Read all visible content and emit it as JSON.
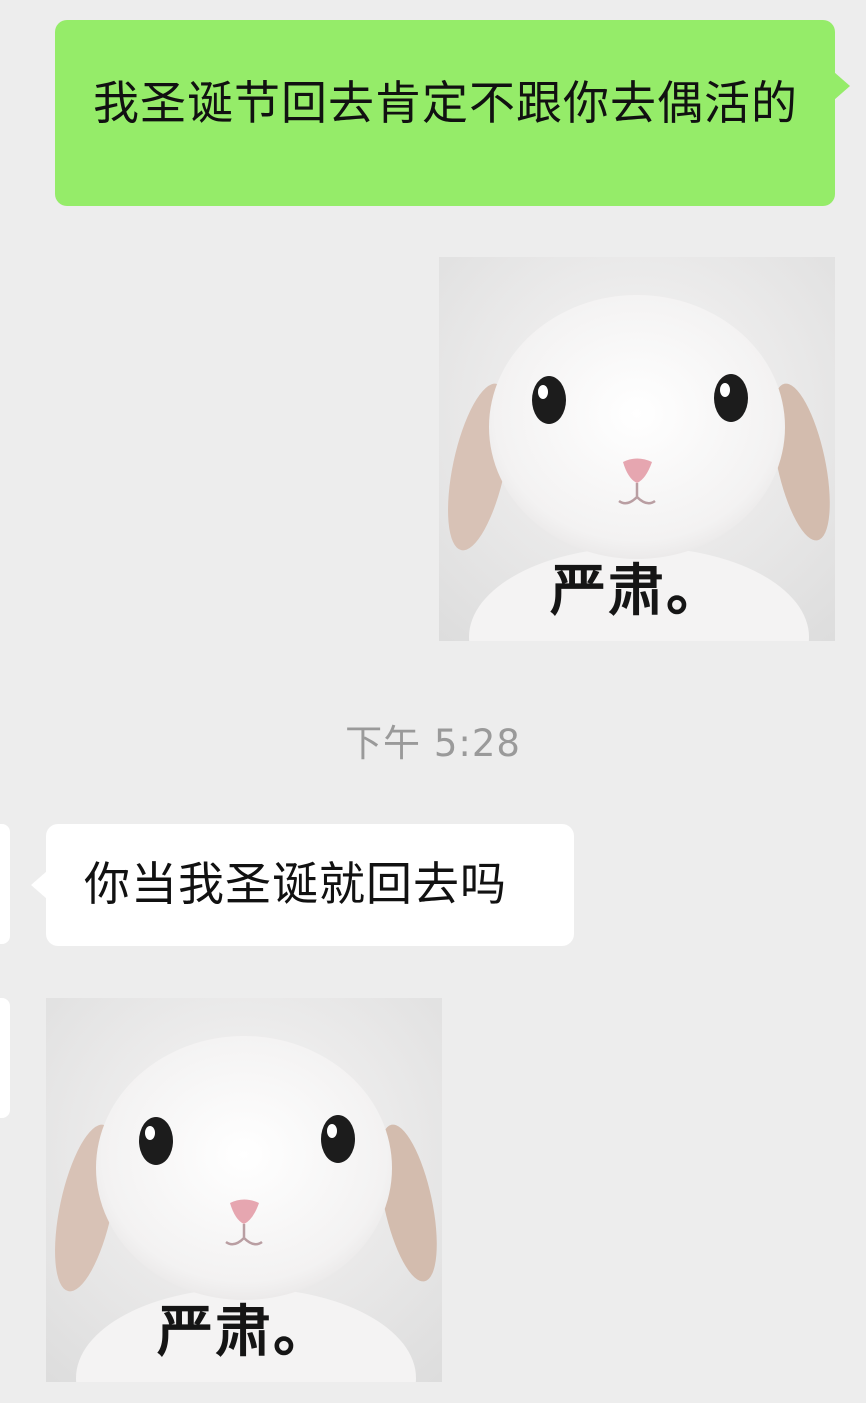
{
  "conversation": {
    "outgoing_message": "我圣诞节回去肯定不跟你去偶活的",
    "timestamp": "下午 5:28",
    "incoming_message": "你当我圣诞就回去吗"
  },
  "stickers": [
    {
      "caption": "严肃。",
      "icon": "white-bunny-sticker",
      "sender": "outgoing"
    },
    {
      "caption": "严肃。",
      "icon": "white-bunny-sticker",
      "sender": "incoming"
    }
  ],
  "colors": {
    "background": "#ededed",
    "outgoing_bubble": "#95ec69",
    "incoming_bubble": "#ffffff",
    "timestamp_text": "#9a9a9a"
  }
}
